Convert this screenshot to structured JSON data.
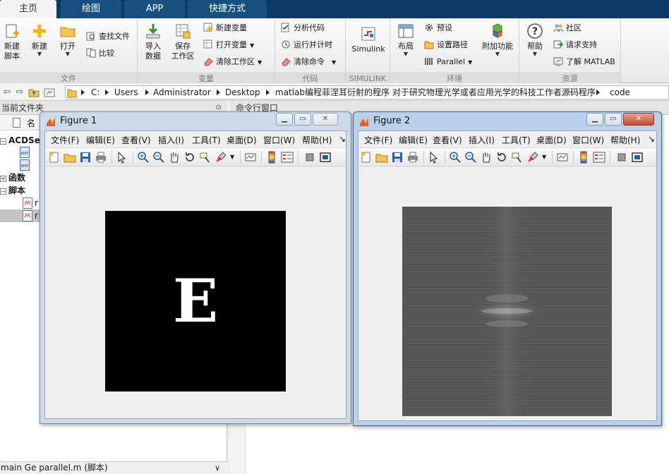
{
  "tabs": [
    {
      "label": "主页",
      "active": true
    },
    {
      "label": "绘图",
      "active": false
    },
    {
      "label": "APP",
      "active": false
    },
    {
      "label": "快捷方式",
      "active": false
    }
  ],
  "ribbon": {
    "file": {
      "label": "文件",
      "new_script": "新建\n脚本",
      "new": "新建",
      "open": "打开",
      "find_files": "查找文件",
      "compare": "比较"
    },
    "variable": {
      "label": "变量",
      "import_data": "导入\n数据",
      "save_workspace": "保存\n工作区",
      "new_variable": "新建变量",
      "open_variable": "打开变量",
      "clear_workspace": "清除工作区"
    },
    "code": {
      "label": "代码",
      "analyze_code": "分析代码",
      "run_and_time": "运行并计时",
      "clear_commands": "清除命令"
    },
    "simulink": {
      "label": "SIMULINK",
      "simulink": "Simulink"
    },
    "environment": {
      "label": "环境",
      "layout": "布局",
      "preferences": "预设",
      "set_path": "设置路径",
      "parallel": "Parallel",
      "add_ons": "附加功能"
    },
    "resources": {
      "label": "资源",
      "help": "帮助",
      "community": "社区",
      "request_support": "请求支持",
      "learn_matlab": "了解 MATLAB"
    }
  },
  "address": {
    "crumbs": [
      "C:",
      "Users",
      "Administrator",
      "Desktop",
      "matlab编程菲涅耳衍射的程序 对于研究物理光学或者应用光学的科技工作者源码程序",
      "code"
    ]
  },
  "left_panel": {
    "title": "当前文件夹",
    "column_name": "名",
    "tree": [
      {
        "label": "ACDSe",
        "kind": "folder"
      },
      {
        "label": "",
        "kind": "bmp"
      },
      {
        "label": "",
        "kind": "bmp"
      },
      {
        "label": "函数",
        "kind": "group"
      },
      {
        "label": "脚本",
        "kind": "group"
      },
      {
        "label": "r",
        "kind": "mfile"
      },
      {
        "label": "r",
        "kind": "mfile",
        "selected": true
      }
    ],
    "status": "main Ge   parallel.m  (脚本)"
  },
  "command_window": {
    "title": "命令行窗口"
  },
  "figure1": {
    "title": "Figure 1",
    "menus": [
      "文件(F)",
      "编辑(E)",
      "查看(V)",
      "插入(I)",
      "工具(T)",
      "桌面(D)",
      "窗口(W)",
      "帮助(H)"
    ],
    "letter": "E"
  },
  "figure2": {
    "title": "Figure 2",
    "menus": [
      "文件(F)",
      "编辑(E)",
      "查看(V)",
      "插入(I)",
      "工具(T)",
      "桌面(D)",
      "窗口(W)",
      "帮助(H)"
    ]
  },
  "colors": {
    "tab_bar": "#0e3a66",
    "figure1_background": "#000000",
    "figure2_background": "#5c5c5c"
  }
}
